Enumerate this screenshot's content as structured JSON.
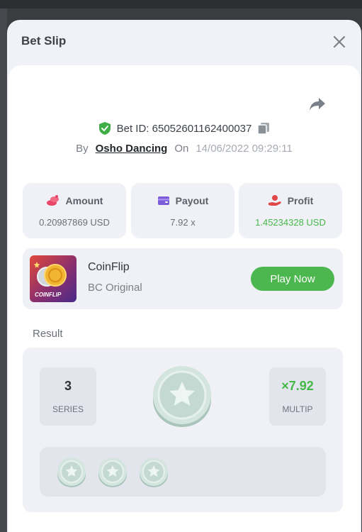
{
  "modal": {
    "title": "Bet Slip"
  },
  "bet": {
    "id_label": "Bet ID: 65052601162400037",
    "by_label": "By",
    "user": "Osho Dancing",
    "on_label": "On",
    "datetime": "14/06/2022 09:29:11"
  },
  "stats": [
    {
      "label": "Amount",
      "value": "0.20987869 USD"
    },
    {
      "label": "Payout",
      "value": "7.92 x"
    },
    {
      "label": "Profit",
      "value": "1.45234328 USD"
    }
  ],
  "game": {
    "name": "CoinFlip",
    "subtitle": "BC Original",
    "thumb_text": "COINFLIP",
    "play_label": "Play Now"
  },
  "result": {
    "label": "Result",
    "series_value": "3",
    "series_label": "SERIES",
    "multiplier_value": "×7.92",
    "multiplier_label": "MULTIP",
    "coin_count": 3
  },
  "colors": {
    "accent_green": "#4cb74e",
    "profit_green": "#45b84a",
    "shield_green": "#3fae46",
    "amount_pink": "#e8476a",
    "payout_purple": "#7b5bd6",
    "profit_red": "#e04848"
  },
  "icons": {
    "close": "close-icon",
    "share": "share-icon",
    "verified": "shield-check-icon",
    "copy": "copy-icon",
    "amount": "coins-icon",
    "payout": "wallet-icon",
    "profit": "hand-coin-icon",
    "coin": "star-coin-icon"
  }
}
